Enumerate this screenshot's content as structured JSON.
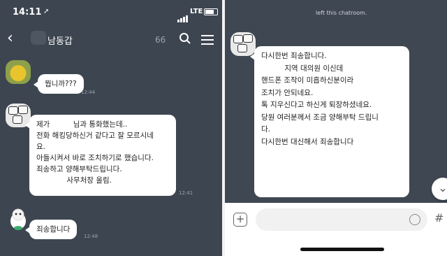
{
  "left": {
    "status": {
      "time": "14:11",
      "network": "LTE"
    },
    "header": {
      "title": "남동갑",
      "member_count": "66"
    },
    "messages": [
      {
        "text": "뭡니까???",
        "time": "12:44"
      },
      {
        "lines": [
          "제가          님과 통화했는데..",
          "전화 해킹당하신거 같다고 잘 모르시네",
          "요.",
          "아들시켜서 바로 조치하기로 했습니다.",
          "죄송하고 양해부탁드립니다.",
          "             사무처장 올림."
        ],
        "time": "12:41"
      },
      {
        "text": "죄송합니다",
        "time": "12:48"
      }
    ]
  },
  "right": {
    "notice": "left this chatroom.",
    "message_lines": [
      "다시한번 죄송합니다.",
      "          지역 대의원 이신데",
      "핸드폰 조작이 미흡하신분이라",
      "조치가 안되네요.",
      "",
      "톡 지우신다고 하신게 퇴장하셨네요.",
      "",
      "당원 여러분께서 조금 양해부탁 드립니",
      "다.",
      "",
      "다시한번 대신해서 죄송합니다"
    ],
    "input": {
      "placeholder": ""
    }
  }
}
